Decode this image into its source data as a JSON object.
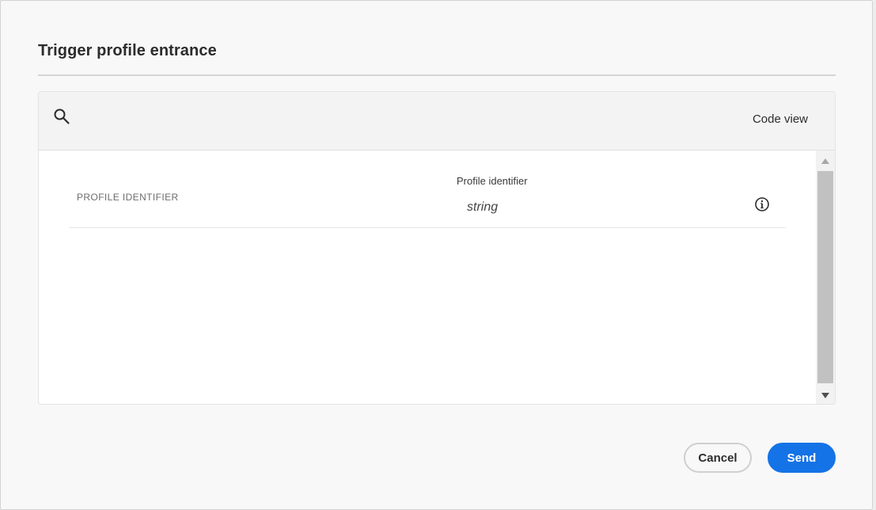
{
  "dialog": {
    "title": "Trigger profile entrance"
  },
  "toolbar": {
    "search_icon": "search-icon",
    "code_view_label": "Code view"
  },
  "fields": [
    {
      "label": "PROFILE IDENTIFIER",
      "sub_label": "Profile identifier",
      "value": "string",
      "info_icon": "info-icon"
    }
  ],
  "footer": {
    "cancel_label": "Cancel",
    "send_label": "Send"
  },
  "colors": {
    "accent": "#1473e6",
    "dialog_background": "#f8f8f8",
    "panel_header": "#f3f3f3"
  }
}
